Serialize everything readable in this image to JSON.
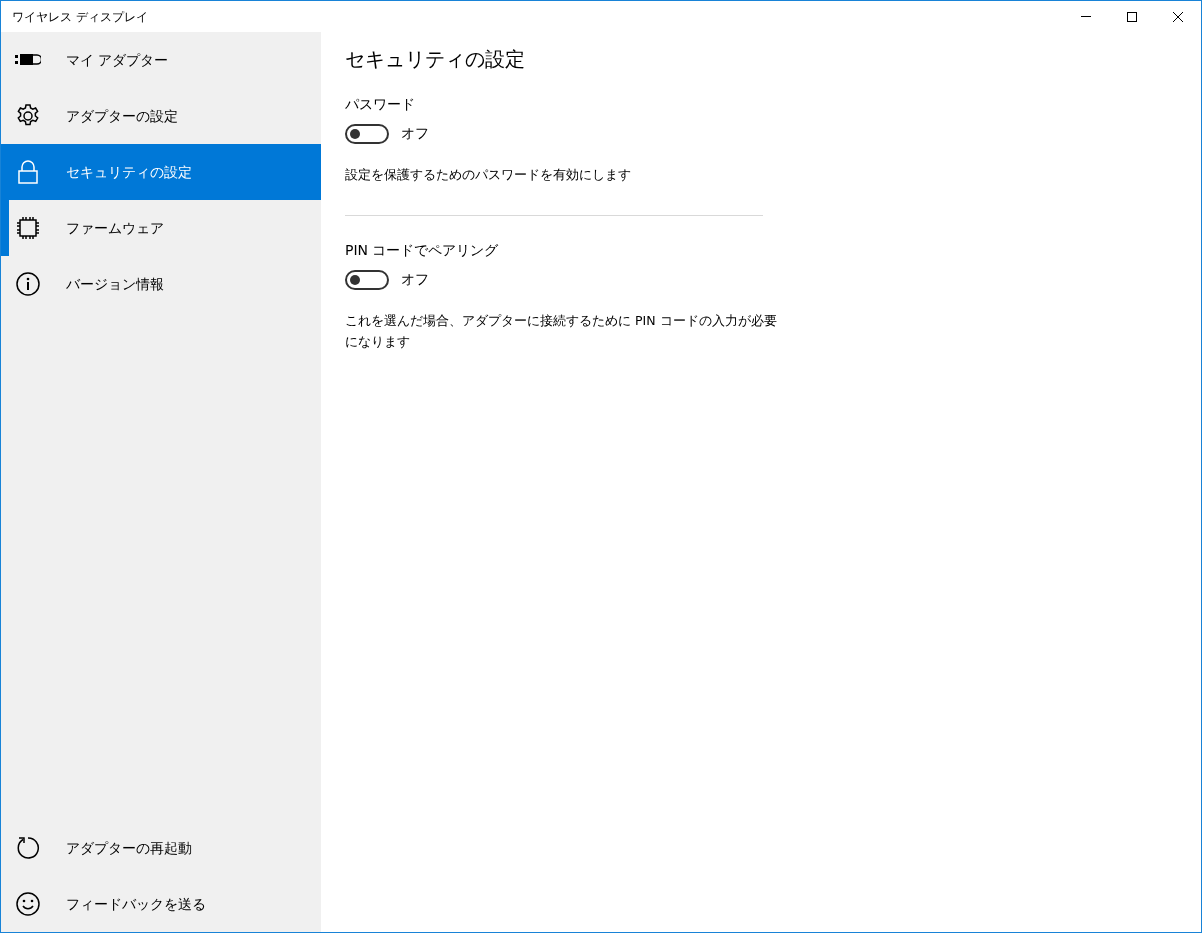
{
  "window": {
    "title": "ワイヤレス ディスプレイ"
  },
  "sidebar": {
    "items": [
      {
        "kind": "adapter",
        "label": "マイ アダプター",
        "selected": false,
        "highlighted": false
      },
      {
        "kind": "gear",
        "label": "アダプターの設定",
        "selected": false,
        "highlighted": false
      },
      {
        "kind": "lock",
        "label": "セキュリティの設定",
        "selected": true,
        "highlighted": false
      },
      {
        "kind": "chip",
        "label": "ファームウェア",
        "selected": false,
        "highlighted": true
      },
      {
        "kind": "info",
        "label": "バージョン情報",
        "selected": false,
        "highlighted": false
      }
    ],
    "bottom_items": [
      {
        "kind": "restart",
        "label": "アダプターの再起動"
      },
      {
        "kind": "smile",
        "label": "フィードバックを送る"
      }
    ]
  },
  "page": {
    "title": "セキュリティの設定",
    "settings": [
      {
        "label": "パスワード",
        "on": false,
        "state_text": "オフ",
        "description": "設定を保護するためのパスワードを有効にします"
      },
      {
        "label": "PIN コードでペアリング",
        "on": false,
        "state_text": "オフ",
        "description": "これを選んだ場合、アダプターに接続するために PIN コードの入力が必要になります"
      }
    ]
  }
}
